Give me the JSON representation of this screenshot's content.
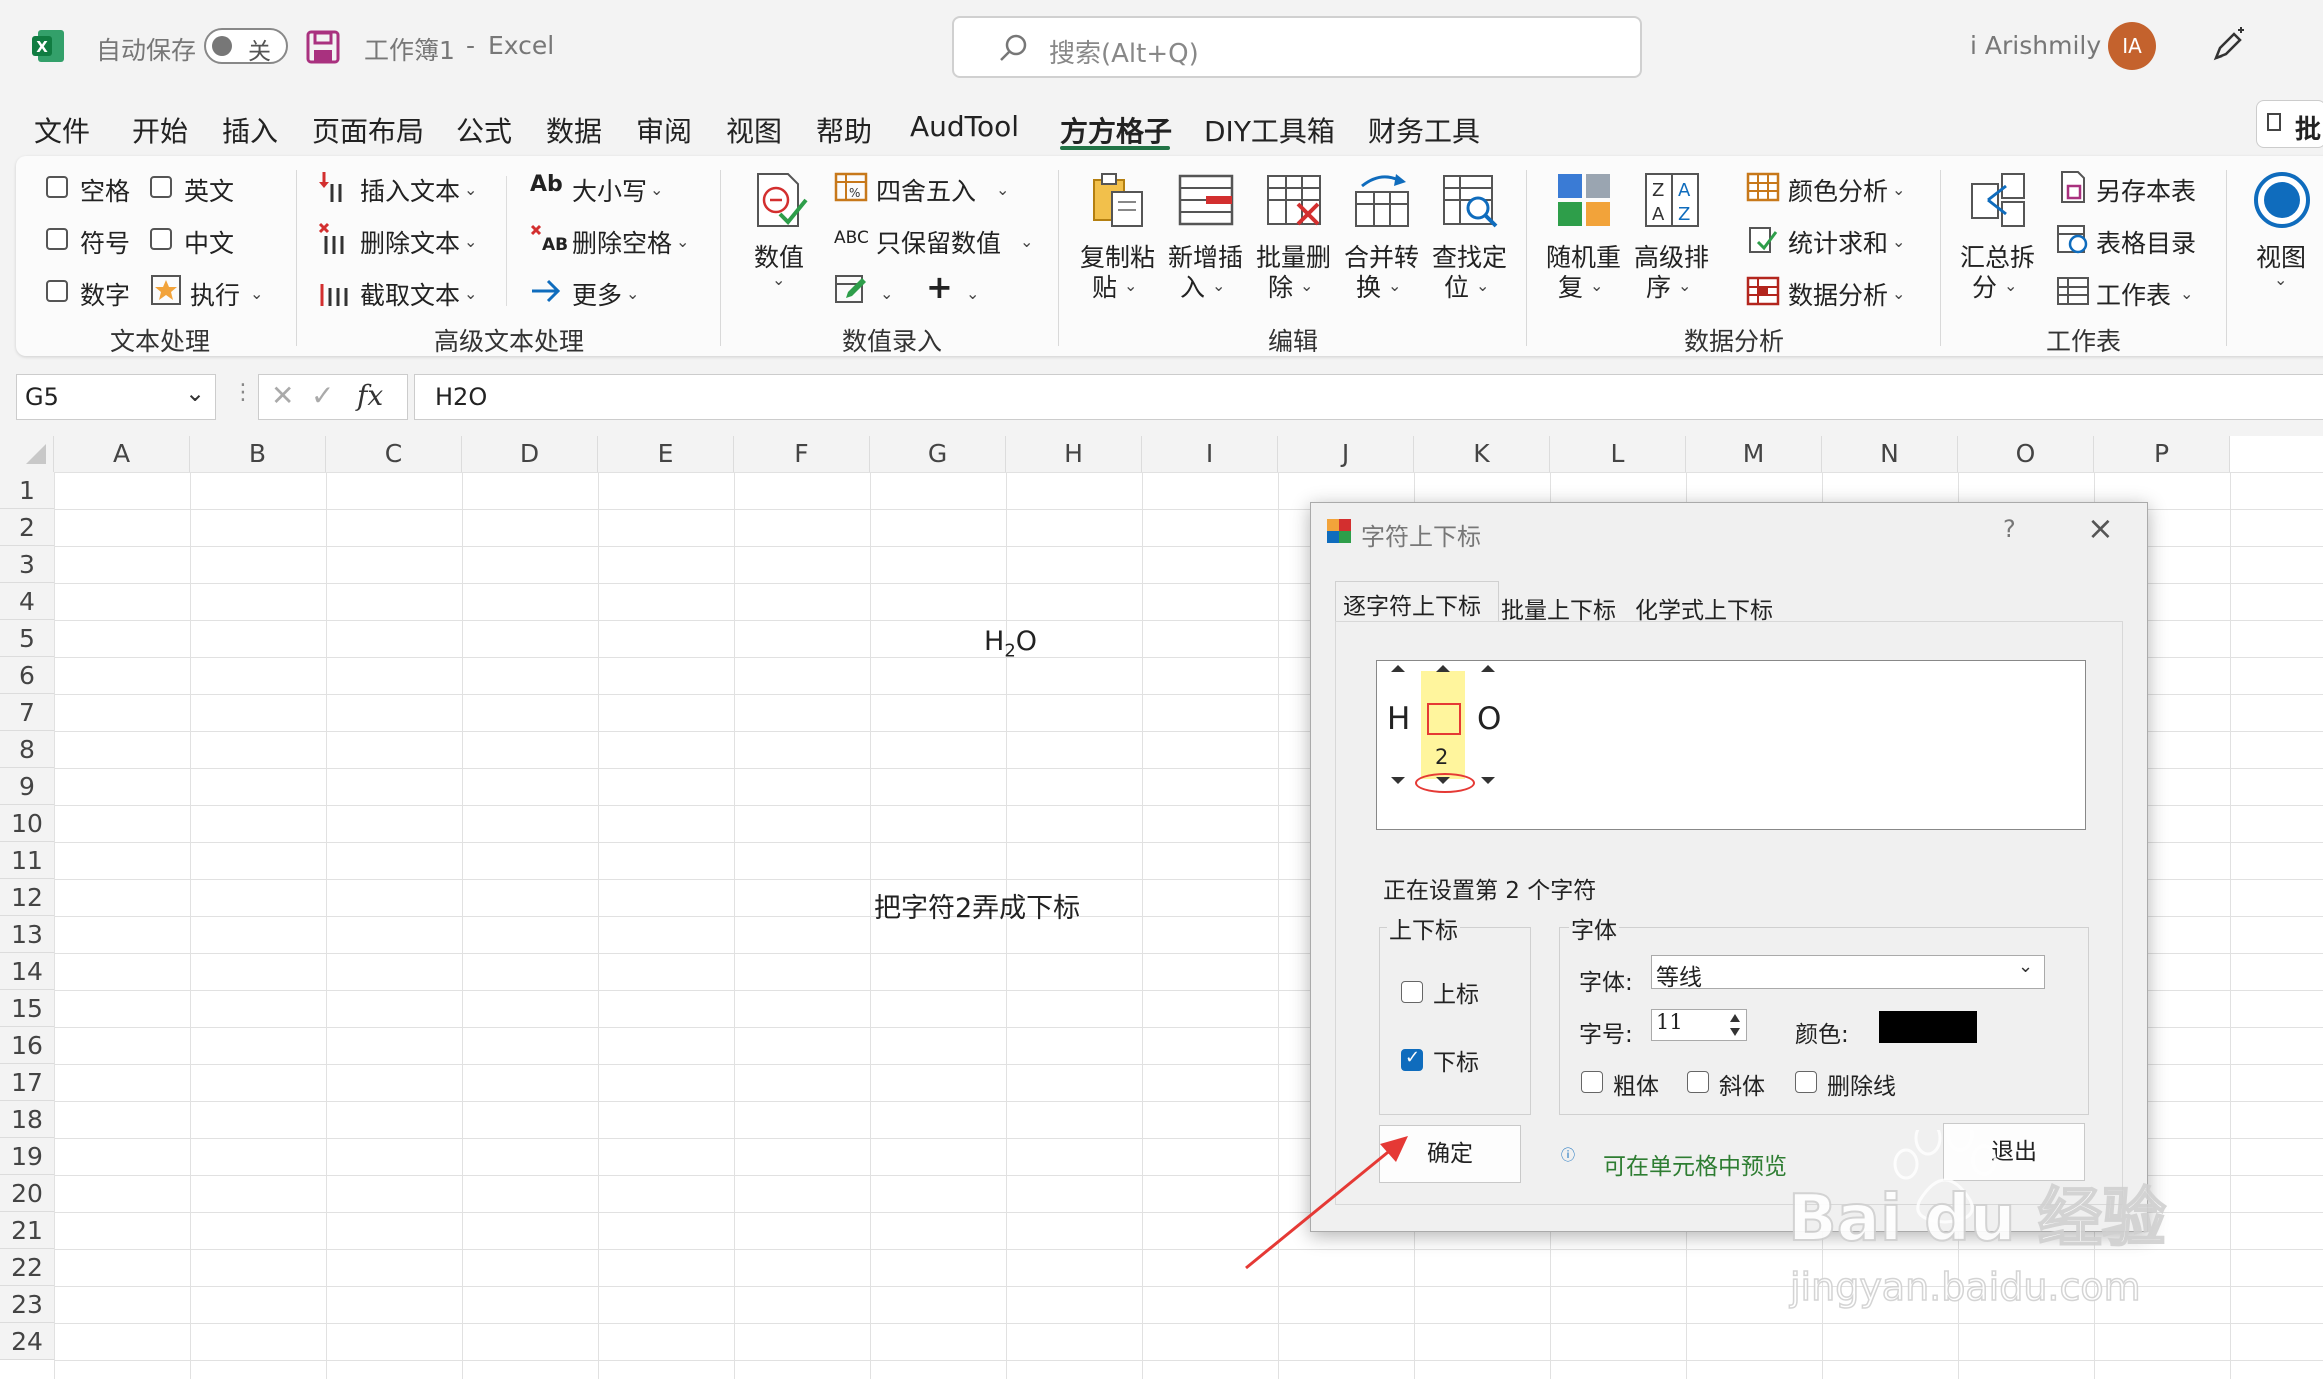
{
  "titlebar": {
    "autosave_label": "自动保存",
    "autosave_toggle": "关",
    "doc_title": "工作簿1",
    "separator": "-",
    "app_name": "Excel",
    "search_placeholder": "搜索(Alt+Q)",
    "user_name": "i Arishmily",
    "avatar_initials": "IA"
  },
  "menu": {
    "tabs": [
      "文件",
      "开始",
      "插入",
      "页面布局",
      "公式",
      "数据",
      "审阅",
      "视图",
      "帮助",
      "AudTool",
      "方方格子",
      "DIY工具箱",
      "财务工具"
    ],
    "active": "方方格子",
    "right_button": "批"
  },
  "ribbon": {
    "text_processing": {
      "items": [
        "空格",
        "英文",
        "符号",
        "中文",
        "数字"
      ],
      "execute": "执行",
      "group": "文本处理"
    },
    "advanced_text": {
      "insert": "插入文本",
      "delete": "删除文本",
      "extract": "截取文本",
      "case": "大小写",
      "delete_space": "删除空格",
      "more": "更多",
      "group": "高级文本处理"
    },
    "number_input": {
      "value": "数值",
      "round": "四舍五入",
      "keep_value": "只保留数值",
      "group": "数值录入"
    },
    "edit": {
      "copy_paste": [
        "复制粘",
        "贴"
      ],
      "new_insert": [
        "新增插",
        "入"
      ],
      "batch_delete": [
        "批量删",
        "除"
      ],
      "merge_convert": [
        "合并转",
        "换"
      ],
      "find_locate": [
        "查找定",
        "位"
      ],
      "group": "编辑"
    },
    "data_analysis": {
      "random_repeat": [
        "随机重",
        "复"
      ],
      "advanced_sort": [
        "高级排",
        "序"
      ],
      "color_analysis": "颜色分析",
      "stat_sum": "统计求和",
      "data_analysis": "数据分析",
      "group": "数据分析"
    },
    "worksheet": {
      "summary_split": [
        "汇总拆",
        "分"
      ],
      "save_sheet": "另存本表",
      "table_catalog": "表格目录",
      "worksheet": "工作表",
      "group": "工作表"
    },
    "view": {
      "label": "视图"
    }
  },
  "formula_bar": {
    "name_box": "G5",
    "fx": "fx",
    "content": "H2O"
  },
  "grid": {
    "columns": [
      "A",
      "B",
      "C",
      "D",
      "E",
      "F",
      "G",
      "H",
      "I",
      "J",
      "K",
      "L",
      "M",
      "N",
      "O",
      "P"
    ],
    "rows": [
      "1",
      "2",
      "3",
      "4",
      "5",
      "6",
      "7",
      "8",
      "9",
      "10",
      "11",
      "12",
      "13",
      "14",
      "15",
      "16",
      "17",
      "18",
      "19",
      "20",
      "21",
      "22",
      "23",
      "24"
    ],
    "cell_g5": {
      "main1": "H",
      "sub": "2",
      "main2": "O"
    },
    "cell_g12": "把字符2弄成下标"
  },
  "dialog": {
    "title": "字符上下标",
    "help": "?",
    "tabs": [
      "逐字符上下标",
      "批量上下标",
      "化学式上下标"
    ],
    "preview_chars": [
      "H",
      "",
      "O"
    ],
    "preview_sub": "2",
    "status": "正在设置第 2 个字符",
    "script_group": "上下标",
    "superscript": "上标",
    "subscript": "下标",
    "font_group": "字体",
    "font_label": "字体:",
    "font_value": "等线",
    "size_label": "字号:",
    "size_value": "11",
    "color_label": "颜色:",
    "color_value": "#000000",
    "bold": "粗体",
    "italic": "斜体",
    "strike": "删除线",
    "ok": "确定",
    "hint": "可在单元格中预览",
    "exit": "退出"
  },
  "watermark": {
    "brand": "Bai du 经验",
    "url": "jingyan.baidu.com"
  },
  "colors": {
    "excel_green": "#217346",
    "checkbox_blue": "#0f6cbd",
    "hint_green": "#2e7d32",
    "arrow_red": "#e53935",
    "avatar": "#c4622d"
  }
}
